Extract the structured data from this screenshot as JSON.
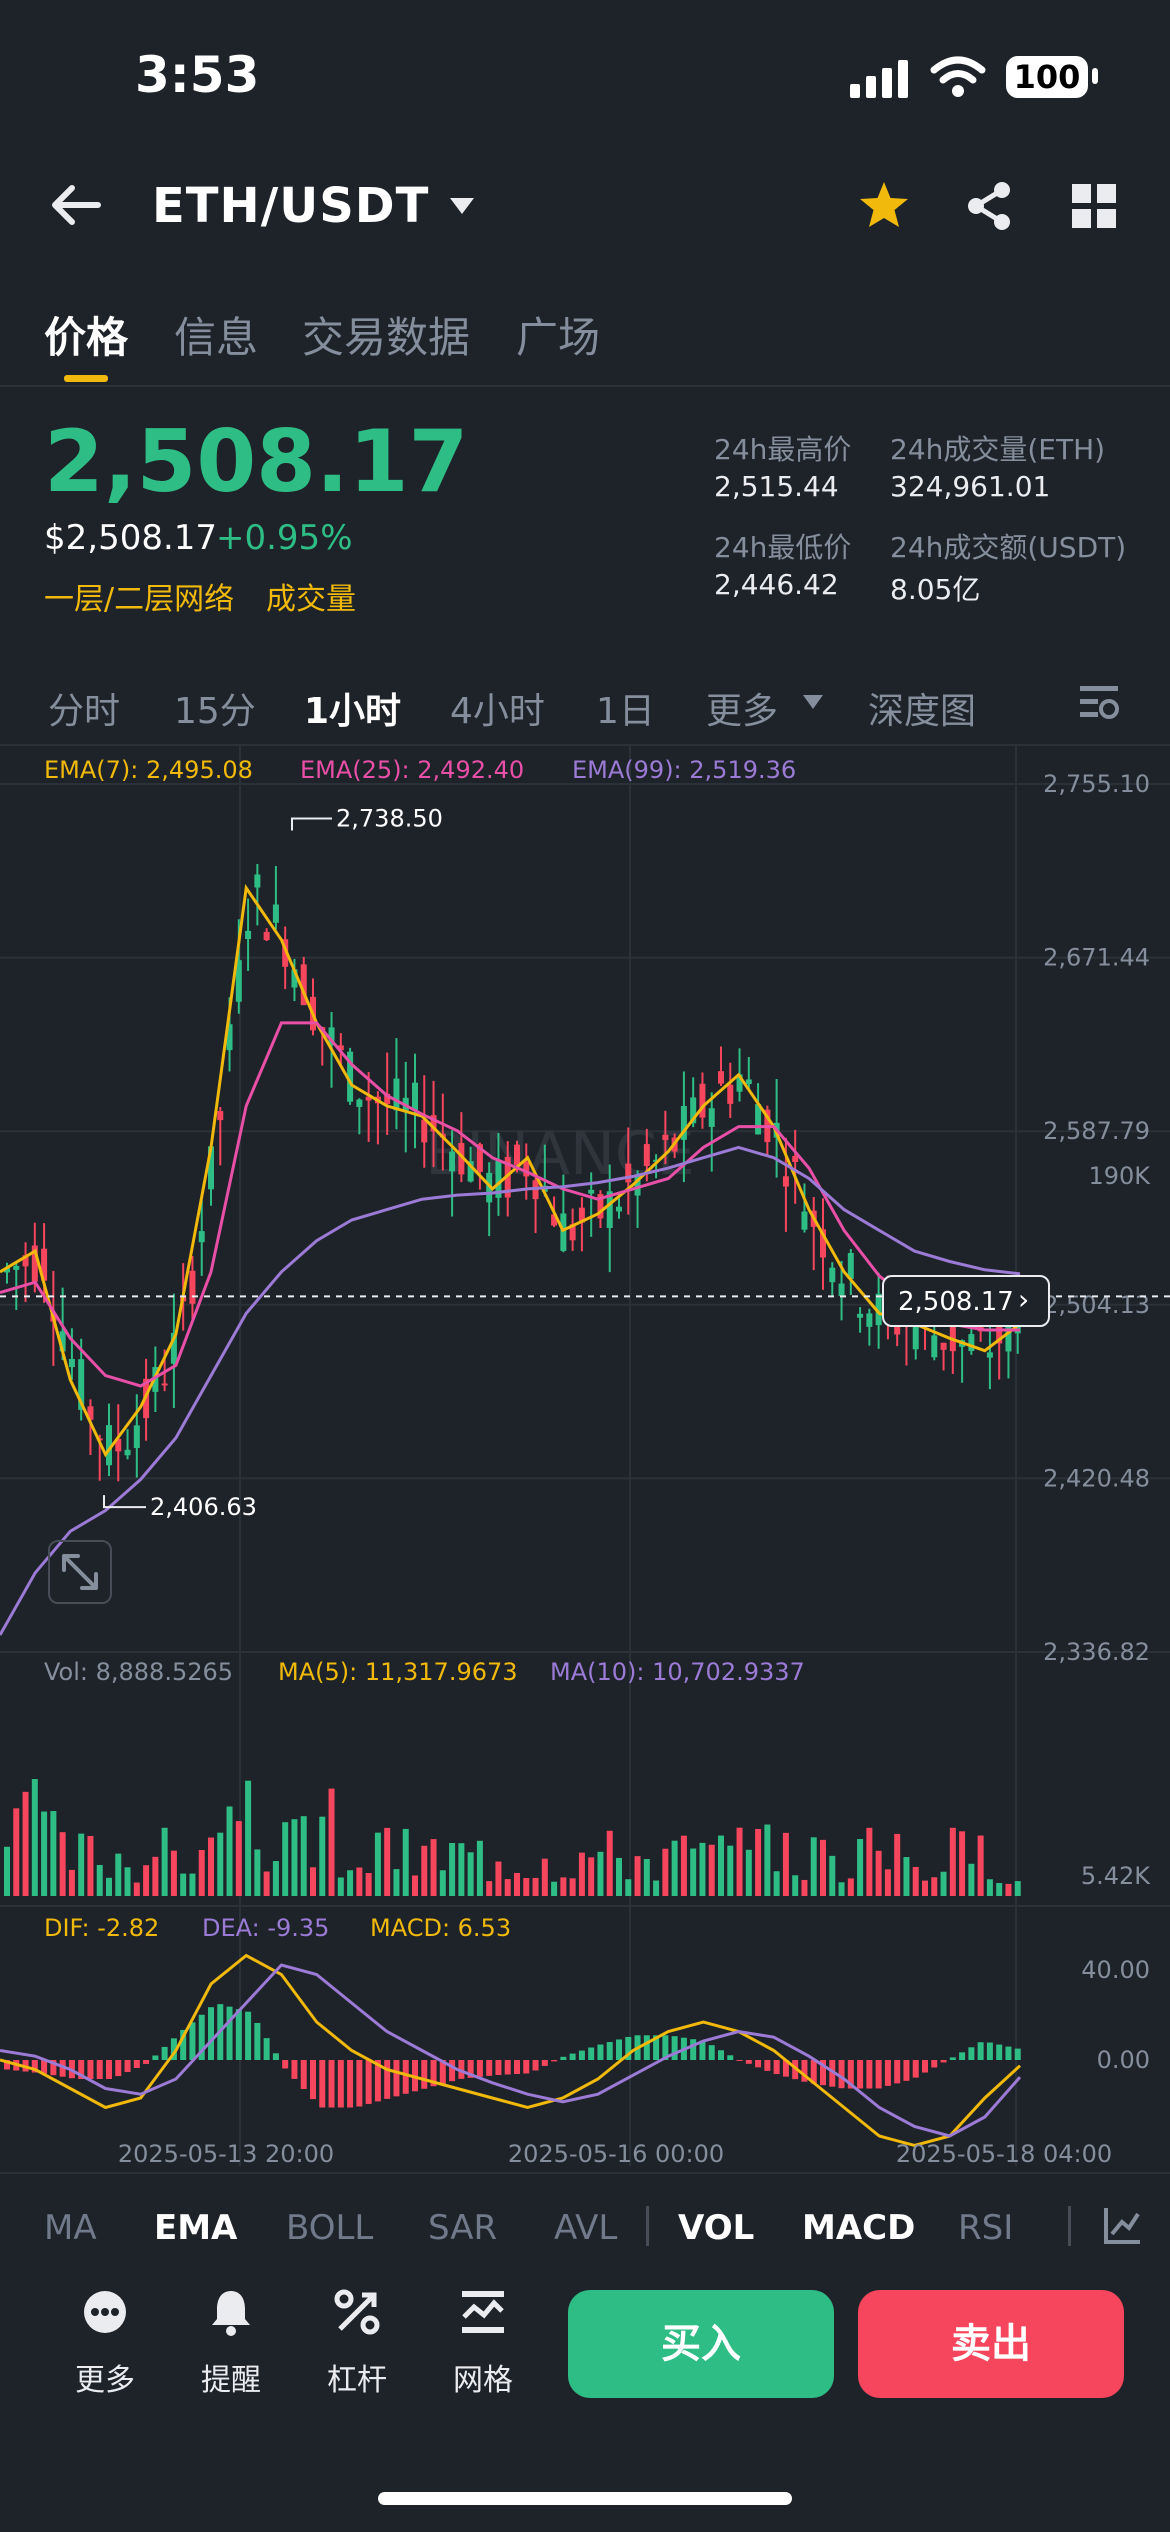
{
  "status_bar": {
    "time": "3:53",
    "battery": "100"
  },
  "header": {
    "pair": "ETH/USDT",
    "icons": [
      "back-arrow-icon",
      "dropdown-caret-icon",
      "star-icon",
      "share-icon",
      "grid-icon"
    ],
    "star_color": "#f0b90b"
  },
  "tabs": [
    {
      "label": "价格",
      "active": true
    },
    {
      "label": "信息"
    },
    {
      "label": "交易数据"
    },
    {
      "label": "广场"
    }
  ],
  "ticker": {
    "last_price": "2,508.17",
    "usd_price": "$2,508.17",
    "change": "+0.95%",
    "network_label": "一层/二层网络",
    "volume_label": "成交量",
    "high_label": "24h最高价",
    "high_value": "2,515.44",
    "low_label": "24h最低价",
    "low_value": "2,446.42",
    "vol_eth_label": "24h成交量(ETH)",
    "vol_eth_value": "324,961.01",
    "vol_usdt_label": "24h成交额(USDT)",
    "vol_usdt_value": "8.05亿"
  },
  "timeframes": [
    {
      "label": "分时"
    },
    {
      "label": "15分"
    },
    {
      "label": "1小时",
      "active": true
    },
    {
      "label": "4小时"
    },
    {
      "label": "1日"
    },
    {
      "label": "更多"
    },
    {
      "label": "深度图"
    }
  ],
  "indicators": {
    "ema7": "EMA(7): 2,495.08",
    "ema25": "EMA(25): 2,492.40",
    "ema99": "EMA(99): 2,519.36",
    "vol": "Vol: 8,888.5265",
    "ma5": "MA(5): 11,317.9673",
    "ma10": "MA(10): 10,702.9337",
    "dif": "DIF: -2.82",
    "dea": "DEA: -9.35",
    "macd": "MACD: 6.53"
  },
  "colors": {
    "up": "#2ebd85",
    "down": "#f6465d",
    "ema7": "#f0b90b",
    "ema25": "#e84fa7",
    "ema99": "#9b7bd6",
    "accent": "#f0b90b"
  },
  "chart_data": [
    {
      "type": "candlestick",
      "y_axis_ticks": [
        "2,755.10",
        "2,671.44",
        "2,587.79",
        "2,504.13",
        "2,420.48",
        "2,336.82"
      ],
      "ylim": [
        2336.82,
        2755.1
      ],
      "x_axis_ticks": [
        "2025-05-13 20:00",
        "2025-05-16 00:00",
        "2025-05-18 04:00"
      ],
      "high_marker": "2,738.50",
      "low_marker": "2,406.63",
      "current_price_tag": "2,508.17",
      "watermark": "BINANCE",
      "series": [
        {
          "name": "EMA(7)",
          "values": [
            2520,
            2530,
            2468,
            2432,
            2455,
            2490,
            2580,
            2705,
            2680,
            2640,
            2610,
            2600,
            2595,
            2578,
            2560,
            2575,
            2540,
            2548,
            2562,
            2578,
            2600,
            2615,
            2590,
            2550,
            2520,
            2500,
            2495,
            2488,
            2482,
            2495
          ]
        },
        {
          "name": "EMA(25)",
          "values": [
            2510,
            2515,
            2488,
            2470,
            2465,
            2475,
            2520,
            2600,
            2640,
            2640,
            2620,
            2605,
            2596,
            2588,
            2575,
            2568,
            2560,
            2555,
            2560,
            2565,
            2580,
            2590,
            2590,
            2570,
            2540,
            2518,
            2505,
            2495,
            2492,
            2492
          ]
        },
        {
          "name": "EMA(99)",
          "values": [
            2345,
            2375,
            2395,
            2405,
            2420,
            2440,
            2470,
            2500,
            2520,
            2535,
            2545,
            2550,
            2555,
            2557,
            2558,
            2560,
            2561,
            2563,
            2566,
            2570,
            2575,
            2580,
            2575,
            2565,
            2550,
            2540,
            2530,
            2525,
            2521,
            2519
          ]
        }
      ]
    },
    {
      "type": "bar",
      "title": "Vol",
      "y_axis_ticks": [
        "190K",
        "5.42K"
      ]
    },
    {
      "type": "bar",
      "title": "MACD",
      "y_axis_ticks": [
        "40.00",
        "0.00"
      ],
      "series": [
        {
          "name": "DIF",
          "values": [
            0,
            -5,
            -15,
            -25,
            -20,
            5,
            40,
            55,
            45,
            20,
            5,
            -5,
            -10,
            -15,
            -20,
            -25,
            -20,
            -10,
            5,
            15,
            20,
            15,
            5,
            -10,
            -25,
            -40,
            -45,
            -40,
            -20,
            -3
          ]
        },
        {
          "name": "DEA",
          "values": [
            5,
            2,
            -5,
            -15,
            -18,
            -10,
            10,
            30,
            50,
            45,
            30,
            15,
            5,
            -5,
            -12,
            -18,
            -22,
            -18,
            -8,
            2,
            10,
            15,
            12,
            2,
            -10,
            -25,
            -35,
            -40,
            -30,
            -9
          ]
        }
      ]
    }
  ],
  "bottom_tabs": [
    {
      "label": "MA"
    },
    {
      "label": "EMA",
      "active": true
    },
    {
      "label": "BOLL"
    },
    {
      "label": "SAR"
    },
    {
      "label": "AVL"
    },
    {
      "label": "VOL",
      "active": true
    },
    {
      "label": "MACD",
      "active": true
    },
    {
      "label": "RSI"
    }
  ],
  "toolbar": [
    {
      "label": "更多",
      "icon": "more-icon"
    },
    {
      "label": "提醒",
      "icon": "bell-icon"
    },
    {
      "label": "杠杆",
      "icon": "leverage-icon"
    },
    {
      "label": "网格",
      "icon": "grid-trading-icon"
    }
  ],
  "buy_label": "买入",
  "sell_label": "卖出"
}
